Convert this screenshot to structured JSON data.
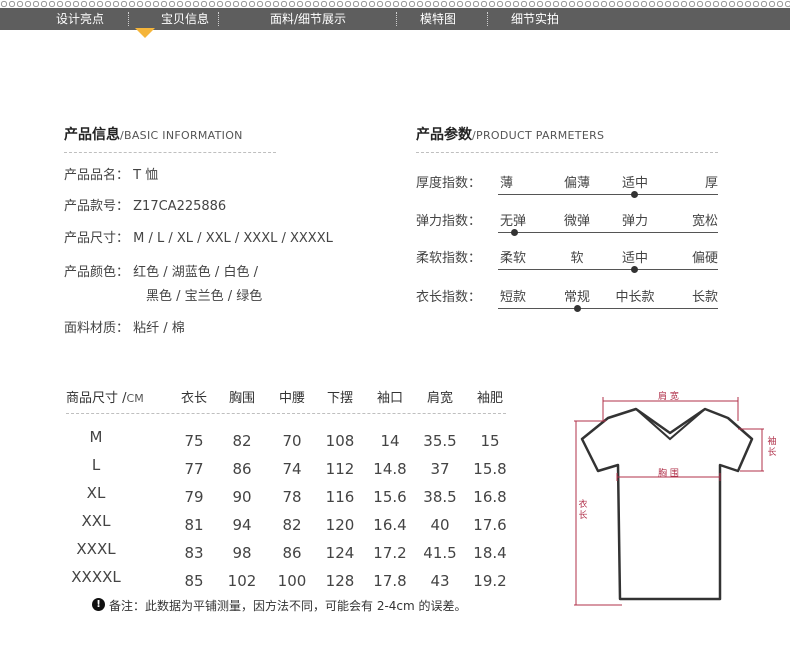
{
  "nav": {
    "items": [
      "设计亮点",
      "宝贝信息",
      "面料/细节展示",
      "模特图",
      "细节实拍"
    ],
    "active_index": 1,
    "colors": {
      "bar": "#5e5e5e",
      "active_marker": "#f5b53a"
    }
  },
  "basic_info": {
    "title": "产品信息",
    "title_en": "/BASIC INFORMATION",
    "rows": [
      {
        "label": "产品品名：",
        "value": "T 恤"
      },
      {
        "label": "产品款号：",
        "value": "Z17CA225886"
      },
      {
        "label": "产品尺寸：",
        "value": "M / L / XL / XXL / XXXL / XXXXL"
      },
      {
        "label": "产品颜色：",
        "value": "红色 / 湖蓝色 / 白色 /",
        "value2": "黑色 / 宝兰色 / 绿色"
      },
      {
        "label": "面料材质：",
        "value": "粘纤 / 棉"
      }
    ]
  },
  "params": {
    "title": "产品参数",
    "title_en": "/PRODUCT PARMETERS",
    "rows": [
      {
        "label": "厚度指数：",
        "options": [
          "薄",
          "偏薄",
          "适中",
          "厚"
        ],
        "selected": 2
      },
      {
        "label": "弹力指数：",
        "options": [
          "无弹",
          "微弹",
          "弹力",
          "宽松"
        ],
        "selected": 0
      },
      {
        "label": "柔软指数：",
        "options": [
          "柔软",
          "软",
          "适中",
          "偏硬"
        ],
        "selected": 2
      },
      {
        "label": "衣长指数：",
        "options": [
          "短款",
          "常规",
          "中长款",
          "长款"
        ],
        "selected": 1
      }
    ]
  },
  "size_table": {
    "header_label": "商品尺寸 /",
    "header_unit": "CM",
    "columns": [
      "衣长",
      "胸围",
      "中腰",
      "下摆",
      "袖口",
      "肩宽",
      "袖肥"
    ],
    "rows": [
      {
        "size": "M",
        "values": [
          "75",
          "82",
          "70",
          "108",
          "14",
          "35.5",
          "15"
        ]
      },
      {
        "size": "L",
        "values": [
          "77",
          "86",
          "74",
          "112",
          "14.8",
          "37",
          "15.8"
        ]
      },
      {
        "size": "XL",
        "values": [
          "79",
          "90",
          "78",
          "116",
          "15.6",
          "38.5",
          "16.8"
        ]
      },
      {
        "size": "XXL",
        "values": [
          "81",
          "94",
          "82",
          "120",
          "16.4",
          "40",
          "17.6"
        ]
      },
      {
        "size": "XXXL",
        "values": [
          "83",
          "98",
          "86",
          "124",
          "17.2",
          "41.5",
          "18.4"
        ]
      },
      {
        "size": "XXXXL",
        "values": [
          "85",
          "102",
          "100",
          "128",
          "17.8",
          "43",
          "19.2"
        ]
      }
    ],
    "note_icon": "!",
    "note": "备注：此数据为平铺测量，因方法不同，可能会有 2-4cm 的误差。"
  },
  "diagram": {
    "labels": {
      "shoulder": "肩 宽",
      "sleeve": "袖长",
      "chest": "胸 围",
      "length": "衣长"
    },
    "colors": {
      "measure": "#b0304a",
      "shirt": "#333333"
    }
  }
}
